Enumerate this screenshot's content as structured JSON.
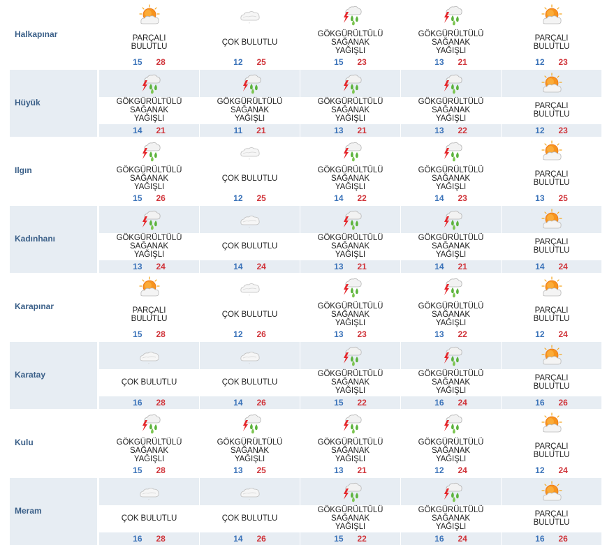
{
  "colors": {
    "row_shade": "#e7edf3",
    "district_name": "#3a5f88",
    "temp_min": "#3b73b9",
    "temp_max": "#d0343a"
  },
  "rows": [
    {
      "name": "Halkapınar",
      "days": [
        {
          "cond": "PARÇALI BULUTLU",
          "icon": "partly-cloudy-icon",
          "min": "15",
          "max": "28"
        },
        {
          "cond": "ÇOK BULUTLU",
          "icon": "cloudy-icon",
          "min": "12",
          "max": "25"
        },
        {
          "cond": "GÖKGÜRÜLTÜLÜ SAĞANAK YAĞIŞLI",
          "icon": "thunderstorm-icon",
          "min": "15",
          "max": "23"
        },
        {
          "cond": "GÖKGÜRÜLTÜLÜ SAĞANAK YAĞIŞLI",
          "icon": "thunderstorm-icon",
          "min": "13",
          "max": "21"
        },
        {
          "cond": "PARÇALI BULUTLU",
          "icon": "partly-cloudy-icon",
          "min": "12",
          "max": "23"
        }
      ]
    },
    {
      "name": "Hüyük",
      "days": [
        {
          "cond": "GÖKGÜRÜLTÜLÜ SAĞANAK YAĞIŞLI",
          "icon": "thunderstorm-icon",
          "min": "14",
          "max": "21"
        },
        {
          "cond": "GÖKGÜRÜLTÜLÜ SAĞANAK YAĞIŞLI",
          "icon": "thunderstorm-icon",
          "min": "11",
          "max": "21"
        },
        {
          "cond": "GÖKGÜRÜLTÜLÜ SAĞANAK YAĞIŞLI",
          "icon": "thunderstorm-icon",
          "min": "13",
          "max": "21"
        },
        {
          "cond": "GÖKGÜRÜLTÜLÜ SAĞANAK YAĞIŞLI",
          "icon": "thunderstorm-icon",
          "min": "13",
          "max": "22"
        },
        {
          "cond": "PARÇALI BULUTLU",
          "icon": "partly-cloudy-icon",
          "min": "12",
          "max": "23"
        }
      ]
    },
    {
      "name": "Ilgın",
      "days": [
        {
          "cond": "GÖKGÜRÜLTÜLÜ SAĞANAK YAĞIŞLI",
          "icon": "thunderstorm-icon",
          "min": "15",
          "max": "26"
        },
        {
          "cond": "ÇOK BULUTLU",
          "icon": "cloudy-icon",
          "min": "12",
          "max": "25"
        },
        {
          "cond": "GÖKGÜRÜLTÜLÜ SAĞANAK YAĞIŞLI",
          "icon": "thunderstorm-icon",
          "min": "14",
          "max": "22"
        },
        {
          "cond": "GÖKGÜRÜLTÜLÜ SAĞANAK YAĞIŞLI",
          "icon": "thunderstorm-icon",
          "min": "14",
          "max": "23"
        },
        {
          "cond": "PARÇALI BULUTLU",
          "icon": "partly-cloudy-icon",
          "min": "13",
          "max": "25"
        }
      ]
    },
    {
      "name": "Kadınhanı",
      "days": [
        {
          "cond": "GÖKGÜRÜLTÜLÜ SAĞANAK YAĞIŞLI",
          "icon": "thunderstorm-icon",
          "min": "13",
          "max": "24"
        },
        {
          "cond": "ÇOK BULUTLU",
          "icon": "cloudy-icon",
          "min": "14",
          "max": "24"
        },
        {
          "cond": "GÖKGÜRÜLTÜLÜ SAĞANAK YAĞIŞLI",
          "icon": "thunderstorm-icon",
          "min": "13",
          "max": "21"
        },
        {
          "cond": "GÖKGÜRÜLTÜLÜ SAĞANAK YAĞIŞLI",
          "icon": "thunderstorm-icon",
          "min": "14",
          "max": "21"
        },
        {
          "cond": "PARÇALI BULUTLU",
          "icon": "partly-cloudy-icon",
          "min": "14",
          "max": "24"
        }
      ]
    },
    {
      "name": "Karapınar",
      "days": [
        {
          "cond": "PARÇALI BULUTLU",
          "icon": "partly-cloudy-icon",
          "min": "15",
          "max": "28"
        },
        {
          "cond": "ÇOK BULUTLU",
          "icon": "cloudy-icon",
          "min": "12",
          "max": "26"
        },
        {
          "cond": "GÖKGÜRÜLTÜLÜ SAĞANAK YAĞIŞLI",
          "icon": "thunderstorm-icon",
          "min": "13",
          "max": "23"
        },
        {
          "cond": "GÖKGÜRÜLTÜLÜ SAĞANAK YAĞIŞLI",
          "icon": "thunderstorm-icon",
          "min": "13",
          "max": "22"
        },
        {
          "cond": "PARÇALI BULUTLU",
          "icon": "partly-cloudy-icon",
          "min": "12",
          "max": "24"
        }
      ]
    },
    {
      "name": "Karatay",
      "days": [
        {
          "cond": "ÇOK BULUTLU",
          "icon": "cloudy-icon",
          "min": "16",
          "max": "28"
        },
        {
          "cond": "ÇOK BULUTLU",
          "icon": "cloudy-icon",
          "min": "14",
          "max": "26"
        },
        {
          "cond": "GÖKGÜRÜLTÜLÜ SAĞANAK YAĞIŞLI",
          "icon": "thunderstorm-icon",
          "min": "15",
          "max": "22"
        },
        {
          "cond": "GÖKGÜRÜLTÜLÜ SAĞANAK YAĞIŞLI",
          "icon": "thunderstorm-icon",
          "min": "16",
          "max": "24"
        },
        {
          "cond": "PARÇALI BULUTLU",
          "icon": "partly-cloudy-icon",
          "min": "16",
          "max": "26"
        }
      ]
    },
    {
      "name": "Kulu",
      "days": [
        {
          "cond": "GÖKGÜRÜLTÜLÜ SAĞANAK YAĞIŞLI",
          "icon": "thunderstorm-icon",
          "min": "15",
          "max": "28"
        },
        {
          "cond": "GÖKGÜRÜLTÜLÜ SAĞANAK YAĞIŞLI",
          "icon": "thunderstorm-icon",
          "min": "13",
          "max": "25"
        },
        {
          "cond": "GÖKGÜRÜLTÜLÜ SAĞANAK YAĞIŞLI",
          "icon": "thunderstorm-icon",
          "min": "13",
          "max": "21"
        },
        {
          "cond": "GÖKGÜRÜLTÜLÜ SAĞANAK YAĞIŞLI",
          "icon": "thunderstorm-icon",
          "min": "12",
          "max": "24"
        },
        {
          "cond": "PARÇALI BULUTLU",
          "icon": "partly-cloudy-icon",
          "min": "12",
          "max": "24"
        }
      ]
    },
    {
      "name": "Meram",
      "days": [
        {
          "cond": "ÇOK BULUTLU",
          "icon": "cloudy-icon",
          "min": "16",
          "max": "28"
        },
        {
          "cond": "ÇOK BULUTLU",
          "icon": "cloudy-icon",
          "min": "14",
          "max": "26"
        },
        {
          "cond": "GÖKGÜRÜLTÜLÜ SAĞANAK YAĞIŞLI",
          "icon": "thunderstorm-icon",
          "min": "15",
          "max": "22"
        },
        {
          "cond": "GÖKGÜRÜLTÜLÜ SAĞANAK YAĞIŞLI",
          "icon": "thunderstorm-icon",
          "min": "16",
          "max": "24"
        },
        {
          "cond": "PARÇALI BULUTLU",
          "icon": "partly-cloudy-icon",
          "min": "16",
          "max": "26"
        }
      ]
    }
  ]
}
